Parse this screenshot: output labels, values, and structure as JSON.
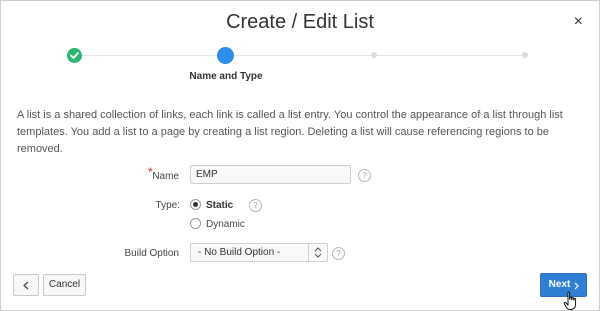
{
  "dialog": {
    "title": "Create / Edit List",
    "close_label": "×"
  },
  "wizard": {
    "current_step_label": "Name and Type"
  },
  "description": "A list is a shared collection of links, each link is called a list entry. You control the appearance of a list through list templates. You add a list to a page by creating a list region. Deleting a list will cause referencing regions to be removed.",
  "form": {
    "name": {
      "required_marker": "*",
      "label": "Name",
      "value": "EMP"
    },
    "type": {
      "label": "Type:",
      "options": [
        {
          "label": "Static",
          "selected": true
        },
        {
          "label": "Dynamic",
          "selected": false
        }
      ]
    },
    "build_option": {
      "label": "Build Option",
      "value": "- No Build Option -"
    },
    "help_glyph": "?"
  },
  "buttons": {
    "cancel": "Cancel",
    "next": "Next"
  },
  "colors": {
    "step_done": "#2bb673",
    "step_current": "#2f8ee5",
    "primary_button": "#2f7fd6",
    "required": "#d3272b"
  }
}
